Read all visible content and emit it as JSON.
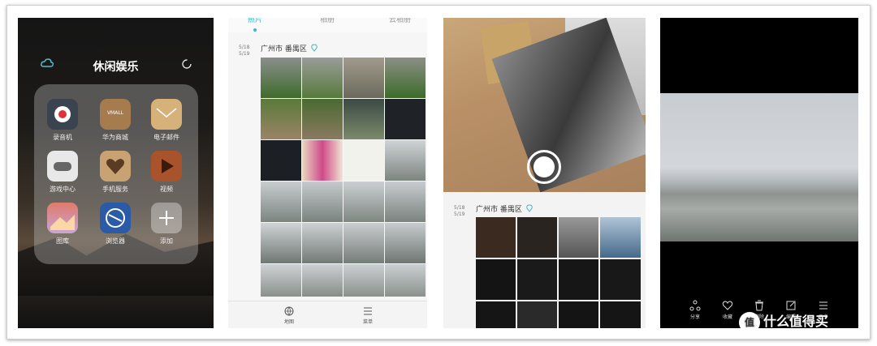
{
  "panel1": {
    "folder_title": "休闲娱乐",
    "apps": [
      {
        "label": "录音机",
        "icon": "recorder-icon"
      },
      {
        "label": "华为商城",
        "icon": "vmall-icon",
        "badge": "VMALL"
      },
      {
        "label": "电子邮件",
        "icon": "email-icon"
      },
      {
        "label": "游戏中心",
        "icon": "gamepad-icon"
      },
      {
        "label": "手机服务",
        "icon": "heart-icon"
      },
      {
        "label": "视频",
        "icon": "video-play-icon"
      },
      {
        "label": "图库",
        "icon": "gallery-icon"
      },
      {
        "label": "浏览器",
        "icon": "browser-icon"
      },
      {
        "label": "添加",
        "icon": "plus-icon"
      }
    ]
  },
  "panel2": {
    "tabs": [
      "照片",
      "相册",
      "云相册"
    ],
    "date_top": "5/18",
    "date_bottom": "5/19",
    "location": "广州市 番禺区",
    "bottom_bar": [
      "地图",
      "菜单"
    ]
  },
  "panel3": {
    "date_top": "5/18",
    "date_bottom": "5/19",
    "location": "广州市 番禺区"
  },
  "panel4": {
    "actions": [
      "分享",
      "收藏",
      "删除",
      "编辑",
      "更多"
    ]
  },
  "watermark": {
    "logo": "值",
    "text": "什么值得买"
  }
}
